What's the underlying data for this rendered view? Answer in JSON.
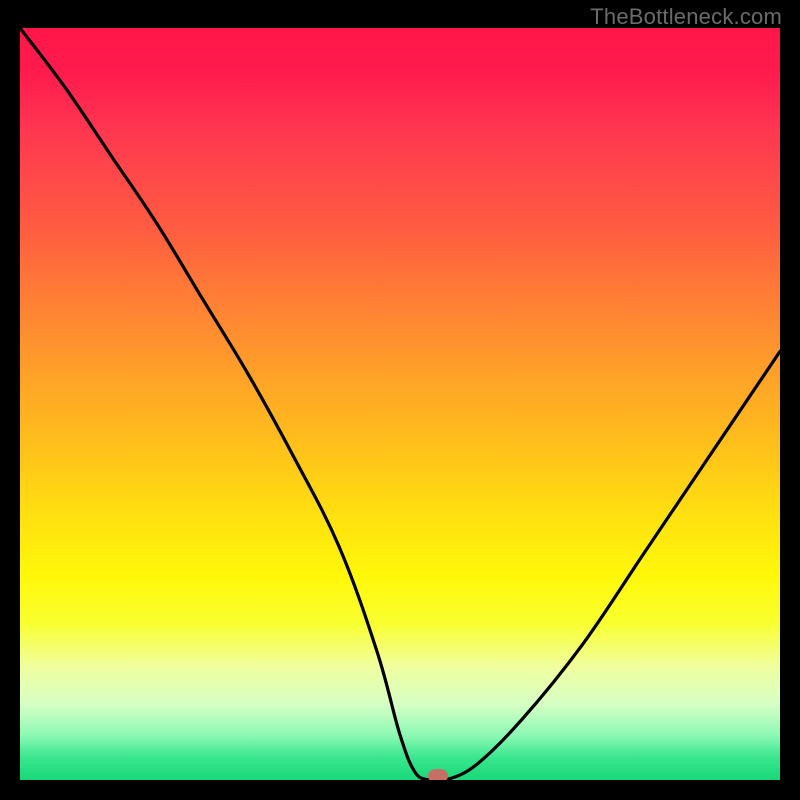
{
  "watermark": "TheBottleneck.com",
  "chart_data": {
    "type": "line",
    "title": "",
    "xlabel": "",
    "ylabel": "",
    "x_range": [
      0,
      100
    ],
    "y_range": [
      0,
      100
    ],
    "grid": false,
    "legend": false,
    "series": [
      {
        "name": "bottleneck-curve",
        "x": [
          0,
          6,
          12,
          18,
          24,
          30,
          36,
          42,
          47,
          50,
          52,
          54,
          56,
          60,
          66,
          74,
          82,
          90,
          100
        ],
        "y": [
          100,
          92,
          83,
          74,
          64,
          54,
          43,
          31,
          17,
          6,
          1,
          0,
          0,
          2,
          8,
          18,
          30,
          42,
          57
        ]
      }
    ],
    "marker": {
      "x": 55,
      "y": 0.5,
      "color": "#c76f65"
    },
    "gradient_stops": [
      {
        "pos": 0,
        "color": "#ff1648"
      },
      {
        "pos": 14,
        "color": "#ff3850"
      },
      {
        "pos": 36,
        "color": "#ff7e35"
      },
      {
        "pos": 57,
        "color": "#ffc519"
      },
      {
        "pos": 73,
        "color": "#fff80a"
      },
      {
        "pos": 90,
        "color": "#d5ffc4"
      },
      {
        "pos": 100,
        "color": "#18d878"
      }
    ]
  }
}
